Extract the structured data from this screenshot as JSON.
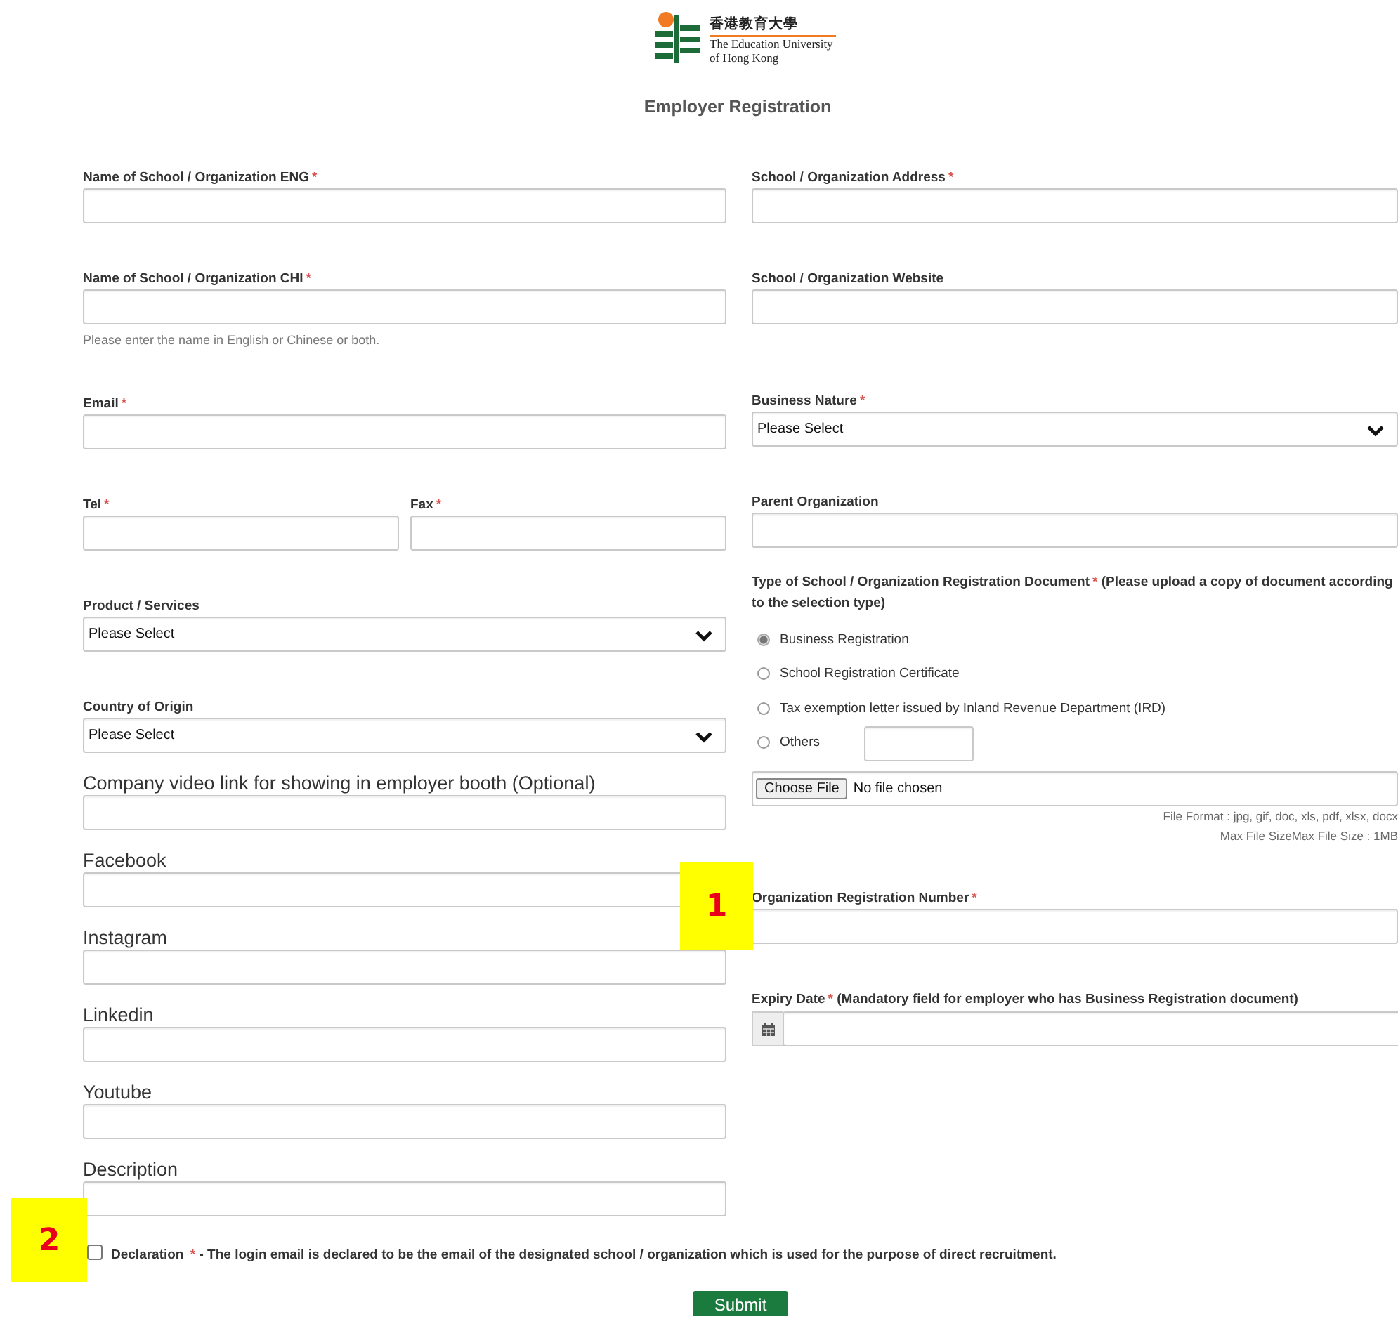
{
  "logo": {
    "chinese": "香港教育大學",
    "english_line_1": "The Education University",
    "english_line_2": "of Hong Kong"
  },
  "title": "Employer Registration",
  "left_fields": [
    {
      "kind": "text",
      "label": "Name of School / Organization ENG",
      "mark": "*"
    },
    {
      "kind": "text",
      "label": "Name of School / Organization CHI",
      "mark": "*",
      "hint": "Please enter the name in English or Chinese or both."
    },
    {
      "kind": "text",
      "label": "Email",
      "mark": "*"
    },
    {
      "kind": "pair",
      "parts": [
        {
          "label": "Tel",
          "mark": "*"
        },
        {
          "label": "Fax",
          "mark": "*"
        }
      ]
    },
    {
      "kind": "select",
      "label": "Product / Services",
      "value": "Please Select"
    },
    {
      "kind": "select",
      "label": "Country of Origin",
      "value": "Please Select"
    },
    {
      "kind": "social",
      "label": "Company video link for showing in employer booth (Optional)"
    },
    {
      "kind": "social",
      "label": "Facebook"
    },
    {
      "kind": "social",
      "label": "Instagram"
    },
    {
      "kind": "social",
      "label": "Linkedin"
    },
    {
      "kind": "social",
      "label": "Youtube"
    },
    {
      "kind": "social",
      "label": "Description"
    }
  ],
  "right_fields": [
    {
      "kind": "text",
      "label": "School / Organization Address",
      "mark": "*"
    },
    {
      "kind": "text",
      "label": "School / Organization Website"
    },
    {
      "kind": "select",
      "label": "Business Nature",
      "mark": "*",
      "value": "Please Select"
    },
    {
      "kind": "text",
      "label": "Parent Organization"
    },
    {
      "kind": "radios",
      "label": "Type of School / Organization Registration Document",
      "mark": "*",
      "note": "(Please upload a copy of document according to the selection type)",
      "options": [
        {
          "kind": "plain",
          "label": "Business Registration",
          "selected": true
        },
        {
          "kind": "plain",
          "label": "School Registration Certificate",
          "selected": false
        },
        {
          "kind": "plain",
          "label": "Tax exemption letter issued by Inland Revenue Department (IRD)",
          "selected": false
        },
        {
          "kind": "with_input",
          "label": "Others",
          "selected": false
        }
      ]
    },
    {
      "kind": "file",
      "button": "Choose File",
      "status": "No file chosen",
      "notes": [
        "File Format : jpg, gif, doc, xls, pdf, xlsx, docx",
        "Max File SizeMax File Size : 1MB"
      ]
    },
    {
      "kind": "text",
      "label": "Organization Registration Number",
      "mark": "*"
    },
    {
      "kind": "date",
      "label": "Expiry Date",
      "mark": "*",
      "note": "(Mandatory field for employer who has Business Registration document)"
    }
  ],
  "declaration": {
    "checked": false,
    "label": "Declaration",
    "mark": "*",
    "text": "- The login email is declared to be the email of the designated school / organization which is used for the purpose of direct recruitment."
  },
  "submit": "Submit",
  "callouts": [
    {
      "number": "1"
    },
    {
      "number": "2"
    }
  ]
}
